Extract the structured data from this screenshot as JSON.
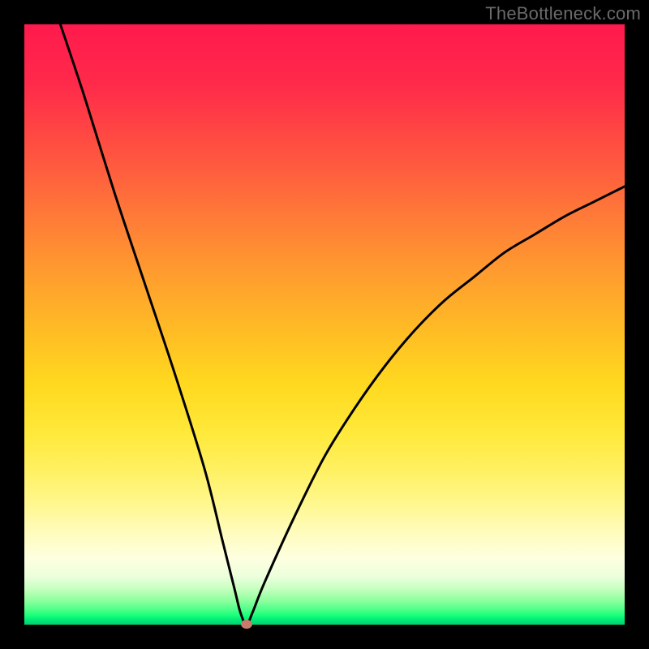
{
  "watermark": "TheBottleneck.com",
  "chart_data": {
    "type": "line",
    "title": "",
    "xlabel": "",
    "ylabel": "",
    "xlim": [
      0,
      100
    ],
    "ylim": [
      0,
      100
    ],
    "grid": false,
    "legend": false,
    "series": [
      {
        "name": "bottleneck-curve",
        "x": [
          6,
          10,
          15,
          20,
          25,
          30,
          33,
          35,
          36,
          37,
          38,
          40,
          45,
          50,
          55,
          60,
          65,
          70,
          75,
          80,
          85,
          90,
          95,
          100
        ],
        "y": [
          100,
          88,
          72,
          57,
          42,
          26,
          14,
          6,
          2,
          0,
          2,
          7,
          18,
          28,
          36,
          43,
          49,
          54,
          58,
          62,
          65,
          68,
          70.5,
          73
        ]
      }
    ],
    "marker": {
      "name": "optimal-point",
      "x": 37,
      "y": 0,
      "color": "#c97a6b"
    },
    "background_gradient": {
      "top_color": "#ff1a4d",
      "middle_color": "#ffd91f",
      "bottom_color": "#00d072"
    }
  }
}
